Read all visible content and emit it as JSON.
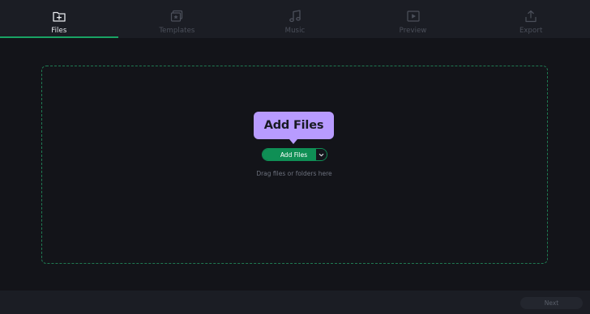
{
  "tabs": [
    {
      "label": "Files",
      "icon": "folder-add-icon",
      "active": true
    },
    {
      "label": "Templates",
      "icon": "templates-icon",
      "active": false
    },
    {
      "label": "Music",
      "icon": "music-note-icon",
      "active": false
    },
    {
      "label": "Preview",
      "icon": "play-preview-icon",
      "active": false
    },
    {
      "label": "Export",
      "icon": "export-upload-icon",
      "active": false
    }
  ],
  "dropzone": {
    "tooltip_text": "Add Files",
    "add_button_label": "Add Files",
    "hint": "Drag files or folders here"
  },
  "footer": {
    "next_label": "Next"
  },
  "colors": {
    "accent": "#19a364",
    "button_green": "#0f8f55",
    "tooltip": "#b89bff",
    "background": "#131419",
    "bar": "#1b1d24"
  }
}
